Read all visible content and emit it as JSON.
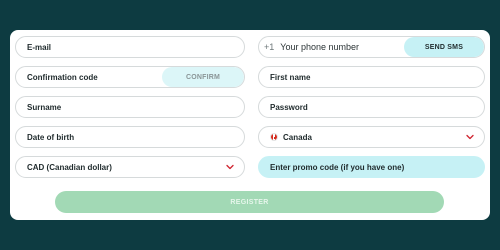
{
  "form": {
    "email": {
      "placeholder": "E-mail"
    },
    "phone": {
      "prefix": "+1",
      "placeholder": "Your phone number",
      "send_button": "SEND SMS"
    },
    "confirmation": {
      "placeholder": "Confirmation code",
      "confirm_button": "CONFIRM"
    },
    "first_name": {
      "placeholder": "First name"
    },
    "surname": {
      "placeholder": "Surname"
    },
    "password": {
      "placeholder": "Password"
    },
    "date_of_birth": {
      "placeholder": "Date of birth"
    },
    "country": {
      "value": "Canada",
      "flag_icon": "canada-flag-icon"
    },
    "currency": {
      "value": "CAD (Canadian dollar)"
    },
    "promo": {
      "placeholder": "Enter promo code (if you have one)"
    },
    "register_button": "REGISTER"
  },
  "colors": {
    "background": "#0d3b41",
    "accent_light": "#c6f1f5",
    "register": "#a2d9b5",
    "chevron": "#d0242f"
  }
}
